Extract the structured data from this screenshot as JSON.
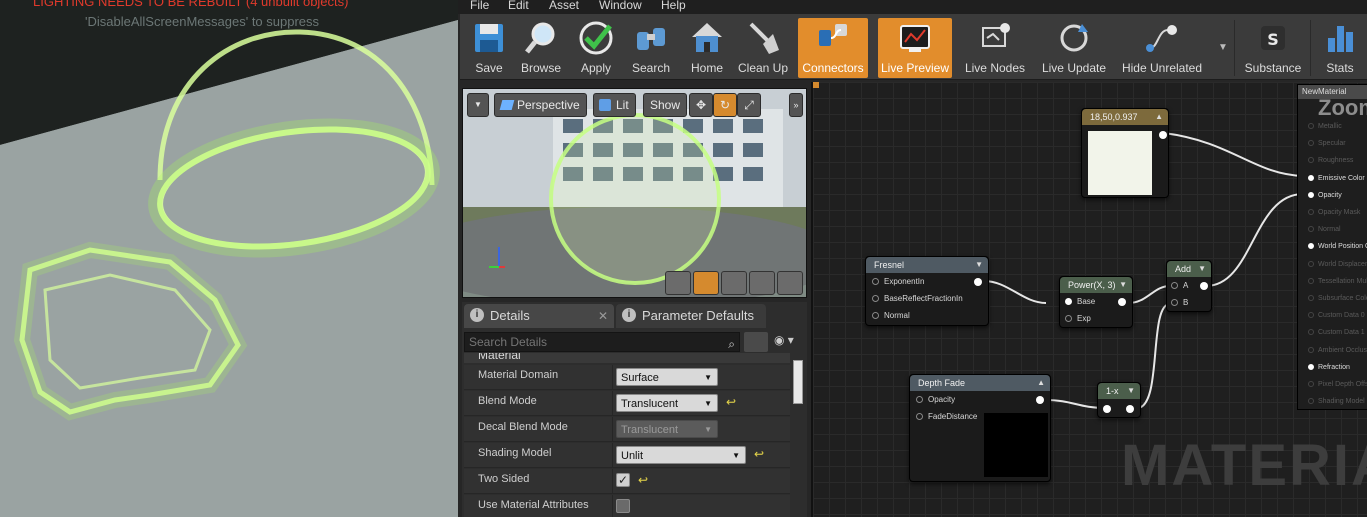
{
  "viewport": {
    "warning": "LIGHTING NEEDS TO BE REBUILT (4 unbuilt objects)",
    "warning_sub": "'DisableAllScreenMessages' to suppress"
  },
  "menu": [
    "File",
    "Edit",
    "Asset",
    "Window",
    "Help"
  ],
  "toolbar": {
    "buttons": [
      "Save",
      "Browse",
      "Apply",
      "Search",
      "Home",
      "Clean Up",
      "Connectors",
      "Live Preview",
      "Live Nodes",
      "Live Update",
      "Hide Unrelated",
      "Substance",
      "Stats"
    ]
  },
  "preview": {
    "perspective": "Perspective",
    "lit": "Lit",
    "show": "Show"
  },
  "details": {
    "tabs": [
      "Details",
      "Parameter Defaults"
    ],
    "search_placeholder": "Search Details",
    "category": "Material",
    "properties": [
      {
        "name": "Material Domain",
        "value": "Surface"
      },
      {
        "name": "Blend Mode",
        "value": "Translucent"
      },
      {
        "name": "Decal Blend Mode",
        "value": "Translucent"
      },
      {
        "name": "Shading Model",
        "value": "Unlit"
      },
      {
        "name": "Two Sided",
        "value": "✓"
      },
      {
        "name": "Use Material Attributes",
        "value": ""
      }
    ]
  },
  "graph": {
    "watermark": "MATERIAL",
    "nodes": {
      "constant": {
        "title": "18,50,0.937"
      },
      "fresnel": {
        "title": "Fresnel",
        "pins": [
          "ExponentIn",
          "BaseReflectFractionIn",
          "Normal"
        ]
      },
      "power": {
        "title": "Power(X, 3)",
        "pins": [
          "Base",
          "Exp"
        ]
      },
      "add": {
        "title": "Add",
        "pins": [
          "A",
          "B"
        ]
      },
      "depthfade": {
        "title": "Depth Fade",
        "pins": [
          "Opacity",
          "FadeDistance"
        ]
      },
      "oneminus": {
        "title": "1-x"
      }
    },
    "result": {
      "title": "NewMaterial",
      "zoom": "Zoom",
      "pins": [
        {
          "label": "Metallic",
          "on": false
        },
        {
          "label": "Specular",
          "on": false
        },
        {
          "label": "Roughness",
          "on": false
        },
        {
          "label": "Emissive Color",
          "on": true
        },
        {
          "label": "Opacity",
          "on": true
        },
        {
          "label": "Opacity Mask",
          "on": false
        },
        {
          "label": "Normal",
          "on": false
        },
        {
          "label": "World Position Offset",
          "on": true
        },
        {
          "label": "World Displacement",
          "on": false
        },
        {
          "label": "Tessellation Multiplier",
          "on": false
        },
        {
          "label": "Subsurface Color",
          "on": false
        },
        {
          "label": "Custom Data 0",
          "on": false
        },
        {
          "label": "Custom Data 1",
          "on": false
        },
        {
          "label": "Ambient Occlusion",
          "on": false
        },
        {
          "label": "Refraction",
          "on": true
        },
        {
          "label": "Pixel Depth Offset",
          "on": false
        },
        {
          "label": "Shading Model",
          "on": false
        }
      ]
    }
  }
}
